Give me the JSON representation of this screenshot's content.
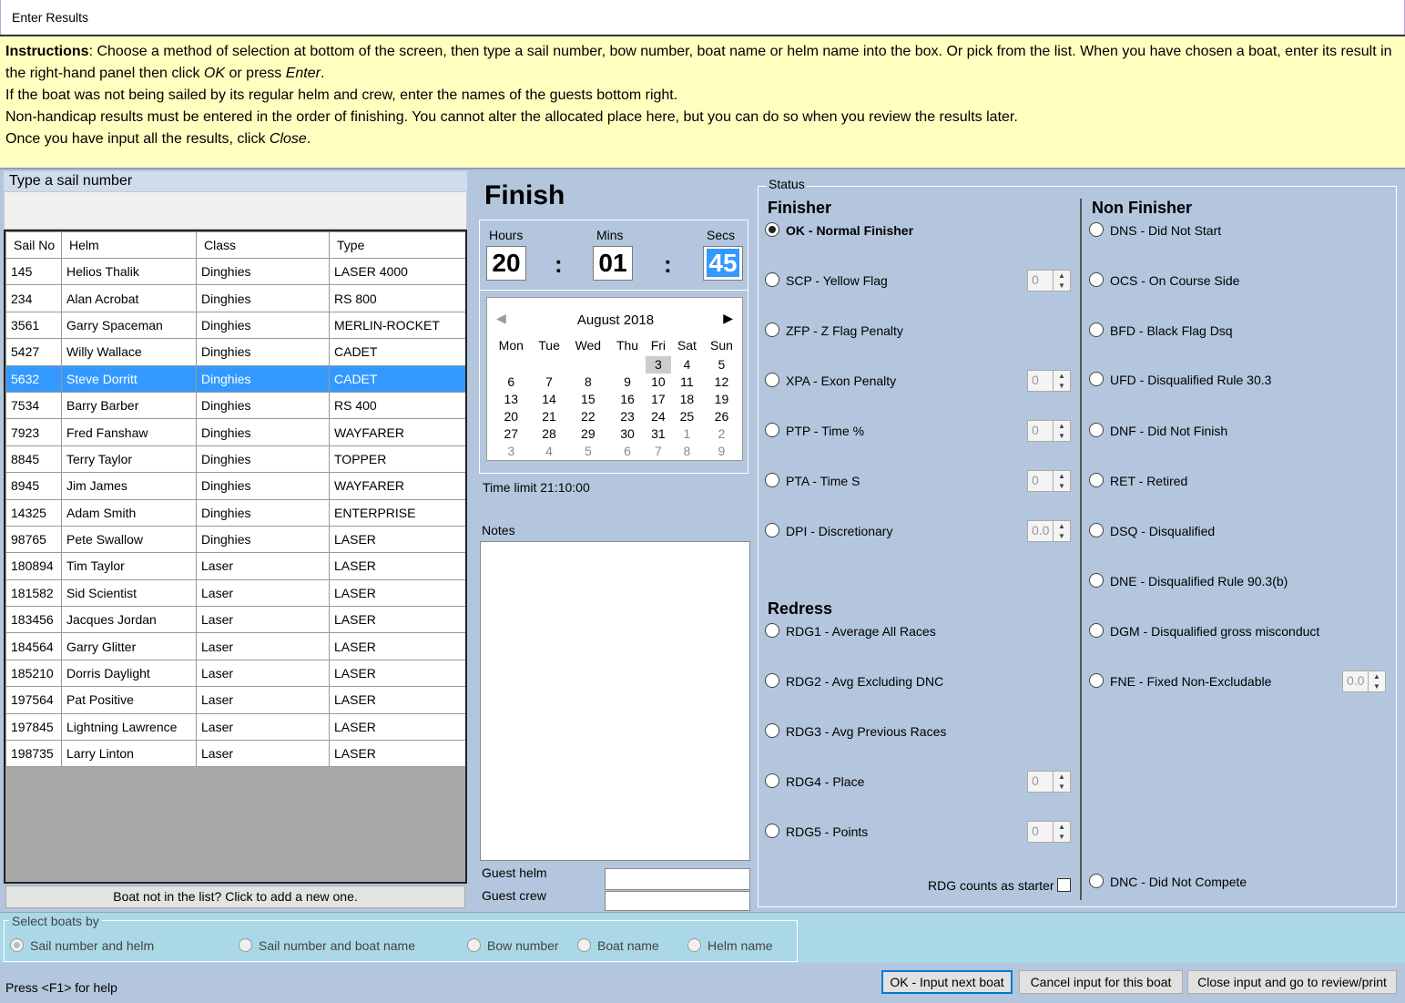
{
  "window": {
    "title": "Enter Results"
  },
  "instructions": {
    "bold": "Instructions",
    "line1a": ": Choose a method of selection at bottom of the screen, then type a sail number, bow number, boat name or helm name into the box. Or pick from the list. When you have chosen a boat, enter its result in the right-hand panel then click ",
    "ok": "OK",
    "line1b": " or press ",
    "enter": "Enter",
    "line1c": ".",
    "line2": "If the boat was not being sailed by its regular helm and crew, enter the names of the guests bottom right.",
    "line3": "Non-handicap results must be entered in the order of finishing. You cannot alter the allocated place here, but you can do so when you review the results later.",
    "line4a": "Once you have input all the results, click ",
    "close": "Close",
    "line4b": "."
  },
  "left": {
    "heading": "Type a sail number",
    "search_value": "",
    "columns": [
      "Sail No",
      "Helm",
      "Class",
      "Type"
    ],
    "rows": [
      [
        "145",
        "Helios Thalik",
        "Dinghies",
        "LASER 4000"
      ],
      [
        "234",
        "Alan Acrobat",
        "Dinghies",
        "RS 800"
      ],
      [
        "3561",
        "Garry Spaceman",
        "Dinghies",
        "MERLIN-ROCKET"
      ],
      [
        "5427",
        "Willy Wallace",
        "Dinghies",
        "CADET"
      ],
      [
        "5632",
        "Steve Dorritt",
        "Dinghies",
        "CADET"
      ],
      [
        "7534",
        "Barry Barber",
        "Dinghies",
        "RS 400"
      ],
      [
        "7923",
        "Fred Fanshaw",
        "Dinghies",
        "WAYFARER"
      ],
      [
        "8845",
        "Terry Taylor",
        "Dinghies",
        "TOPPER"
      ],
      [
        "8945",
        "Jim James",
        "Dinghies",
        "WAYFARER"
      ],
      [
        "14325",
        "Adam Smith",
        "Dinghies",
        "ENTERPRISE"
      ],
      [
        "98765",
        "Pete Swallow",
        "Dinghies",
        "LASER"
      ],
      [
        "180894",
        "Tim Taylor",
        "Laser",
        "LASER"
      ],
      [
        "181582",
        "Sid Scientist",
        "Laser",
        "LASER"
      ],
      [
        "183456",
        "Jacques Jordan",
        "Laser",
        "LASER"
      ],
      [
        "184564",
        "Garry Glitter",
        "Laser",
        "LASER"
      ],
      [
        "185210",
        "Dorris Daylight",
        "Laser",
        "LASER"
      ],
      [
        "197564",
        "Pat Positive",
        "Laser",
        "LASER"
      ],
      [
        "197845",
        "Lightning Lawrence",
        "Laser",
        "LASER"
      ],
      [
        "198735",
        "Larry Linton",
        "Laser",
        "LASER"
      ]
    ],
    "selected_index": 4,
    "add_boat": "Boat not in the list? Click to add a new one."
  },
  "finish": {
    "title": "Finish",
    "hours_label": "Hours",
    "mins_label": "Mins",
    "secs_label": "Secs",
    "hours": "20",
    "mins": "01",
    "secs": "45",
    "colon": ":",
    "calendar": {
      "month": "August 2018",
      "days": [
        "Mon",
        "Tue",
        "Wed",
        "Thu",
        "Fri",
        "Sat",
        "Sun"
      ],
      "weeks": [
        [
          "",
          "",
          "",
          "",
          "3",
          "4",
          "5"
        ],
        [
          "6",
          "7",
          "8",
          "9",
          "10",
          "11",
          "12"
        ],
        [
          "13",
          "14",
          "15",
          "16",
          "17",
          "18",
          "19"
        ],
        [
          "20",
          "21",
          "22",
          "23",
          "24",
          "25",
          "26"
        ],
        [
          "27",
          "28",
          "29",
          "30",
          "31",
          "1",
          "2"
        ],
        [
          "3",
          "4",
          "5",
          "6",
          "7",
          "8",
          "9"
        ]
      ],
      "selected_day": "3"
    },
    "time_limit": "Time limit 21:10:00",
    "notes_label": "Notes",
    "notes_value": "",
    "guest_helm_label": "Guest helm",
    "guest_crew_label": "Guest crew",
    "guest_helm_value": "",
    "guest_crew_value": ""
  },
  "status": {
    "label": "Status",
    "finisher_title": "Finisher",
    "finisher": [
      {
        "label": "OK - Normal Finisher",
        "checked": true,
        "spin": null
      },
      {
        "label": "SCP - Yellow Flag",
        "checked": false,
        "spin": "0"
      },
      {
        "label": "ZFP - Z Flag Penalty",
        "checked": false,
        "spin": null
      },
      {
        "label": "XPA - Exon Penalty",
        "checked": false,
        "spin": "0"
      },
      {
        "label": "PTP - Time %",
        "checked": false,
        "spin": "0"
      },
      {
        "label": "PTA - Time S",
        "checked": false,
        "spin": "0"
      },
      {
        "label": "DPI - Discretionary",
        "checked": false,
        "spin": "0.0"
      }
    ],
    "redress_title": "Redress",
    "redress": [
      {
        "label": "RDG1 - Average All Races",
        "checked": false,
        "spin": null
      },
      {
        "label": "RDG2 - Avg Excluding DNC",
        "checked": false,
        "spin": null
      },
      {
        "label": "RDG3 - Avg Previous Races",
        "checked": false,
        "spin": null
      },
      {
        "label": "RDG4 - Place",
        "checked": false,
        "spin": "0"
      },
      {
        "label": "RDG5 - Points",
        "checked": false,
        "spin": "0"
      }
    ],
    "rdg_counts": "RDG counts as starter",
    "nonfinisher_title": "Non Finisher",
    "nonfinisher": [
      {
        "label": "DNS - Did Not Start",
        "checked": false,
        "spin": null
      },
      {
        "label": "OCS - On Course Side",
        "checked": false,
        "spin": null
      },
      {
        "label": "BFD - Black Flag Dsq",
        "checked": false,
        "spin": null
      },
      {
        "label": "UFD - Disqualified Rule 30.3",
        "checked": false,
        "spin": null
      },
      {
        "label": "DNF - Did Not Finish",
        "checked": false,
        "spin": null
      },
      {
        "label": "RET - Retired",
        "checked": false,
        "spin": null
      },
      {
        "label": "DSQ - Disqualified",
        "checked": false,
        "spin": null
      },
      {
        "label": "DNE - Disqualified Rule 90.3(b)",
        "checked": false,
        "spin": null
      },
      {
        "label": "DGM - Disqualified gross misconduct",
        "checked": false,
        "spin": null
      },
      {
        "label": "FNE - Fixed Non-Excludable",
        "checked": false,
        "spin": "0.0"
      }
    ],
    "dnc": "DNC - Did Not Compete"
  },
  "select_by": {
    "label": "Select boats by",
    "options": [
      "Sail number and helm",
      "Sail number and boat name",
      "Bow number",
      "Boat name",
      "Helm name"
    ],
    "selected": 0
  },
  "footer": {
    "help": "Press <F1> for help",
    "ok_next": "OK - Input next boat",
    "cancel": "Cancel input for this boat",
    "close_review": "Close input and go to review/print"
  }
}
